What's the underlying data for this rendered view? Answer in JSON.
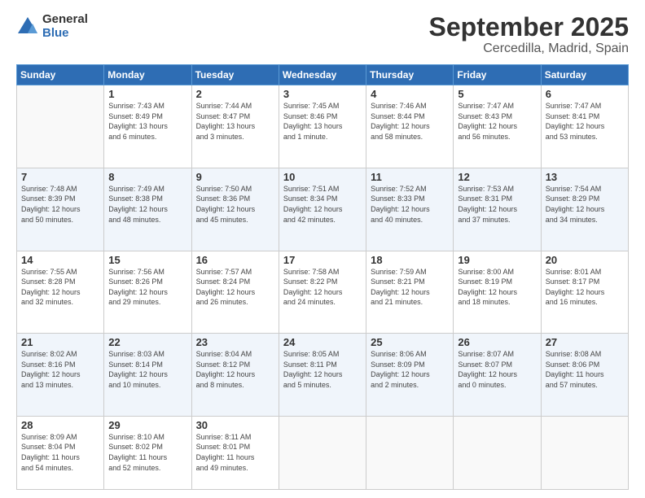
{
  "logo": {
    "general": "General",
    "blue": "Blue"
  },
  "title": "September 2025",
  "subtitle": "Cercedilla, Madrid, Spain",
  "days_header": [
    "Sunday",
    "Monday",
    "Tuesday",
    "Wednesday",
    "Thursday",
    "Friday",
    "Saturday"
  ],
  "weeks": [
    [
      {
        "day": "",
        "info": ""
      },
      {
        "day": "1",
        "info": "Sunrise: 7:43 AM\nSunset: 8:49 PM\nDaylight: 13 hours\nand 6 minutes."
      },
      {
        "day": "2",
        "info": "Sunrise: 7:44 AM\nSunset: 8:47 PM\nDaylight: 13 hours\nand 3 minutes."
      },
      {
        "day": "3",
        "info": "Sunrise: 7:45 AM\nSunset: 8:46 PM\nDaylight: 13 hours\nand 1 minute."
      },
      {
        "day": "4",
        "info": "Sunrise: 7:46 AM\nSunset: 8:44 PM\nDaylight: 12 hours\nand 58 minutes."
      },
      {
        "day": "5",
        "info": "Sunrise: 7:47 AM\nSunset: 8:43 PM\nDaylight: 12 hours\nand 56 minutes."
      },
      {
        "day": "6",
        "info": "Sunrise: 7:47 AM\nSunset: 8:41 PM\nDaylight: 12 hours\nand 53 minutes."
      }
    ],
    [
      {
        "day": "7",
        "info": "Sunrise: 7:48 AM\nSunset: 8:39 PM\nDaylight: 12 hours\nand 50 minutes."
      },
      {
        "day": "8",
        "info": "Sunrise: 7:49 AM\nSunset: 8:38 PM\nDaylight: 12 hours\nand 48 minutes."
      },
      {
        "day": "9",
        "info": "Sunrise: 7:50 AM\nSunset: 8:36 PM\nDaylight: 12 hours\nand 45 minutes."
      },
      {
        "day": "10",
        "info": "Sunrise: 7:51 AM\nSunset: 8:34 PM\nDaylight: 12 hours\nand 42 minutes."
      },
      {
        "day": "11",
        "info": "Sunrise: 7:52 AM\nSunset: 8:33 PM\nDaylight: 12 hours\nand 40 minutes."
      },
      {
        "day": "12",
        "info": "Sunrise: 7:53 AM\nSunset: 8:31 PM\nDaylight: 12 hours\nand 37 minutes."
      },
      {
        "day": "13",
        "info": "Sunrise: 7:54 AM\nSunset: 8:29 PM\nDaylight: 12 hours\nand 34 minutes."
      }
    ],
    [
      {
        "day": "14",
        "info": "Sunrise: 7:55 AM\nSunset: 8:28 PM\nDaylight: 12 hours\nand 32 minutes."
      },
      {
        "day": "15",
        "info": "Sunrise: 7:56 AM\nSunset: 8:26 PM\nDaylight: 12 hours\nand 29 minutes."
      },
      {
        "day": "16",
        "info": "Sunrise: 7:57 AM\nSunset: 8:24 PM\nDaylight: 12 hours\nand 26 minutes."
      },
      {
        "day": "17",
        "info": "Sunrise: 7:58 AM\nSunset: 8:22 PM\nDaylight: 12 hours\nand 24 minutes."
      },
      {
        "day": "18",
        "info": "Sunrise: 7:59 AM\nSunset: 8:21 PM\nDaylight: 12 hours\nand 21 minutes."
      },
      {
        "day": "19",
        "info": "Sunrise: 8:00 AM\nSunset: 8:19 PM\nDaylight: 12 hours\nand 18 minutes."
      },
      {
        "day": "20",
        "info": "Sunrise: 8:01 AM\nSunset: 8:17 PM\nDaylight: 12 hours\nand 16 minutes."
      }
    ],
    [
      {
        "day": "21",
        "info": "Sunrise: 8:02 AM\nSunset: 8:16 PM\nDaylight: 12 hours\nand 13 minutes."
      },
      {
        "day": "22",
        "info": "Sunrise: 8:03 AM\nSunset: 8:14 PM\nDaylight: 12 hours\nand 10 minutes."
      },
      {
        "day": "23",
        "info": "Sunrise: 8:04 AM\nSunset: 8:12 PM\nDaylight: 12 hours\nand 8 minutes."
      },
      {
        "day": "24",
        "info": "Sunrise: 8:05 AM\nSunset: 8:11 PM\nDaylight: 12 hours\nand 5 minutes."
      },
      {
        "day": "25",
        "info": "Sunrise: 8:06 AM\nSunset: 8:09 PM\nDaylight: 12 hours\nand 2 minutes."
      },
      {
        "day": "26",
        "info": "Sunrise: 8:07 AM\nSunset: 8:07 PM\nDaylight: 12 hours\nand 0 minutes."
      },
      {
        "day": "27",
        "info": "Sunrise: 8:08 AM\nSunset: 8:06 PM\nDaylight: 11 hours\nand 57 minutes."
      }
    ],
    [
      {
        "day": "28",
        "info": "Sunrise: 8:09 AM\nSunset: 8:04 PM\nDaylight: 11 hours\nand 54 minutes."
      },
      {
        "day": "29",
        "info": "Sunrise: 8:10 AM\nSunset: 8:02 PM\nDaylight: 11 hours\nand 52 minutes."
      },
      {
        "day": "30",
        "info": "Sunrise: 8:11 AM\nSunset: 8:01 PM\nDaylight: 11 hours\nand 49 minutes."
      },
      {
        "day": "",
        "info": ""
      },
      {
        "day": "",
        "info": ""
      },
      {
        "day": "",
        "info": ""
      },
      {
        "day": "",
        "info": ""
      }
    ]
  ]
}
